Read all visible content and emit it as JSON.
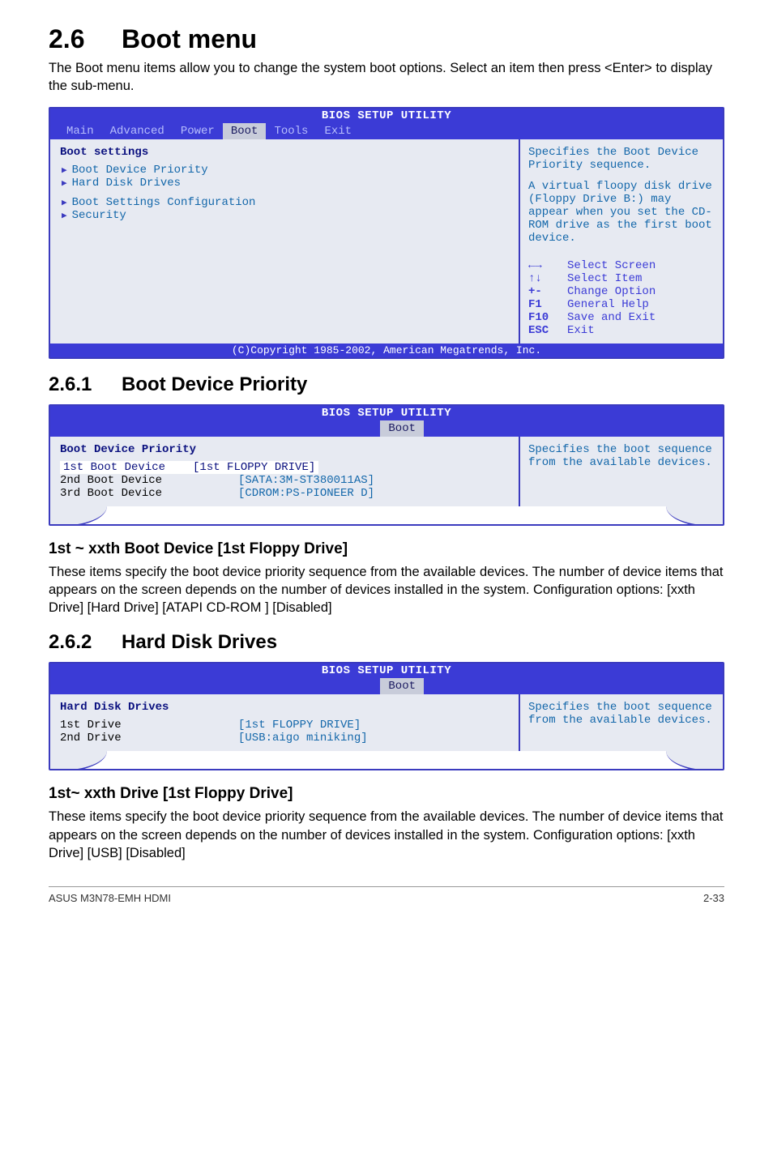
{
  "section": {
    "number": "2.6",
    "title": "Boot menu"
  },
  "intro": "The Boot menu items allow you to change the system boot options. Select an item then press <Enter> to display the sub-menu.",
  "bios_main": {
    "title": "BIOS SETUP UTILITY",
    "tabs": [
      "Main",
      "Advanced",
      "Power",
      "Boot",
      "Tools",
      "Exit"
    ],
    "active_tab": "Boot",
    "left_heading": "Boot settings",
    "items": [
      "Boot Device Priority",
      "Hard Disk Drives",
      "Boot Settings Configuration",
      "Security"
    ],
    "help1": "Specifies the Boot Device Priority sequence.",
    "help2": "A virtual floopy disk drive (Floppy Drive B:) may appear when you set the CD-ROM drive as the first boot device.",
    "nav": [
      {
        "key": "←→",
        "label": "Select Screen"
      },
      {
        "key": "↑↓",
        "label": "Select Item"
      },
      {
        "key": "+-",
        "label": "Change Option"
      },
      {
        "key": "F1",
        "label": "General Help"
      },
      {
        "key": "F10",
        "label": "Save and Exit"
      },
      {
        "key": "ESC",
        "label": "Exit"
      }
    ],
    "copyright": "(C)Copyright 1985-2002, American Megatrends, Inc."
  },
  "s261": {
    "number": "2.6.1",
    "title": "Boot Device Priority"
  },
  "bios_bdp": {
    "title": "BIOS SETUP UTILITY",
    "active_tab": "Boot",
    "heading": "Boot Device Priority",
    "rows": [
      {
        "label": "1st Boot Device",
        "value": "[1st FLOPPY DRIVE]",
        "hl": true
      },
      {
        "label": "2nd Boot Device",
        "value": "[SATA:3M-ST380011AS]",
        "hl": false
      },
      {
        "label": "3rd Boot Device",
        "value": "[CDROM:PS-PIONEER D]",
        "hl": false
      }
    ],
    "help": "Specifies the boot sequence from the available devices."
  },
  "h_1st_xxth": "1st ~ xxth Boot Device [1st Floppy Drive]",
  "p_1st_xxth": "These items specify the boot device priority sequence from the available devices. The number of device items that appears on the screen depends on the number of devices installed in the system. Configuration options: [xxth Drive] [Hard Drive] [ATAPI CD-ROM ] [Disabled]",
  "s262": {
    "number": "2.6.2",
    "title": "Hard Disk Drives"
  },
  "bios_hdd": {
    "title": "BIOS SETUP UTILITY",
    "active_tab": "Boot",
    "heading": "Hard Disk Drives",
    "rows": [
      {
        "label": "1st Drive",
        "value": "[1st FLOPPY DRIVE]"
      },
      {
        "label": "2nd Drive",
        "value": "[USB:aigo miniking]"
      }
    ],
    "help": "Specifies the boot sequence from the available devices."
  },
  "h_hdd_xxth": "1st~ xxth Drive [1st Floppy Drive]",
  "p_hdd_xxth": "These items specify the boot device priority sequence from the available devices. The number of device items that appears on the screen depends on the number of devices installed in the system. Configuration options: [xxth Drive] [USB] [Disabled]",
  "footer": {
    "left": "ASUS M3N78-EMH HDMI",
    "right": "2-33"
  }
}
